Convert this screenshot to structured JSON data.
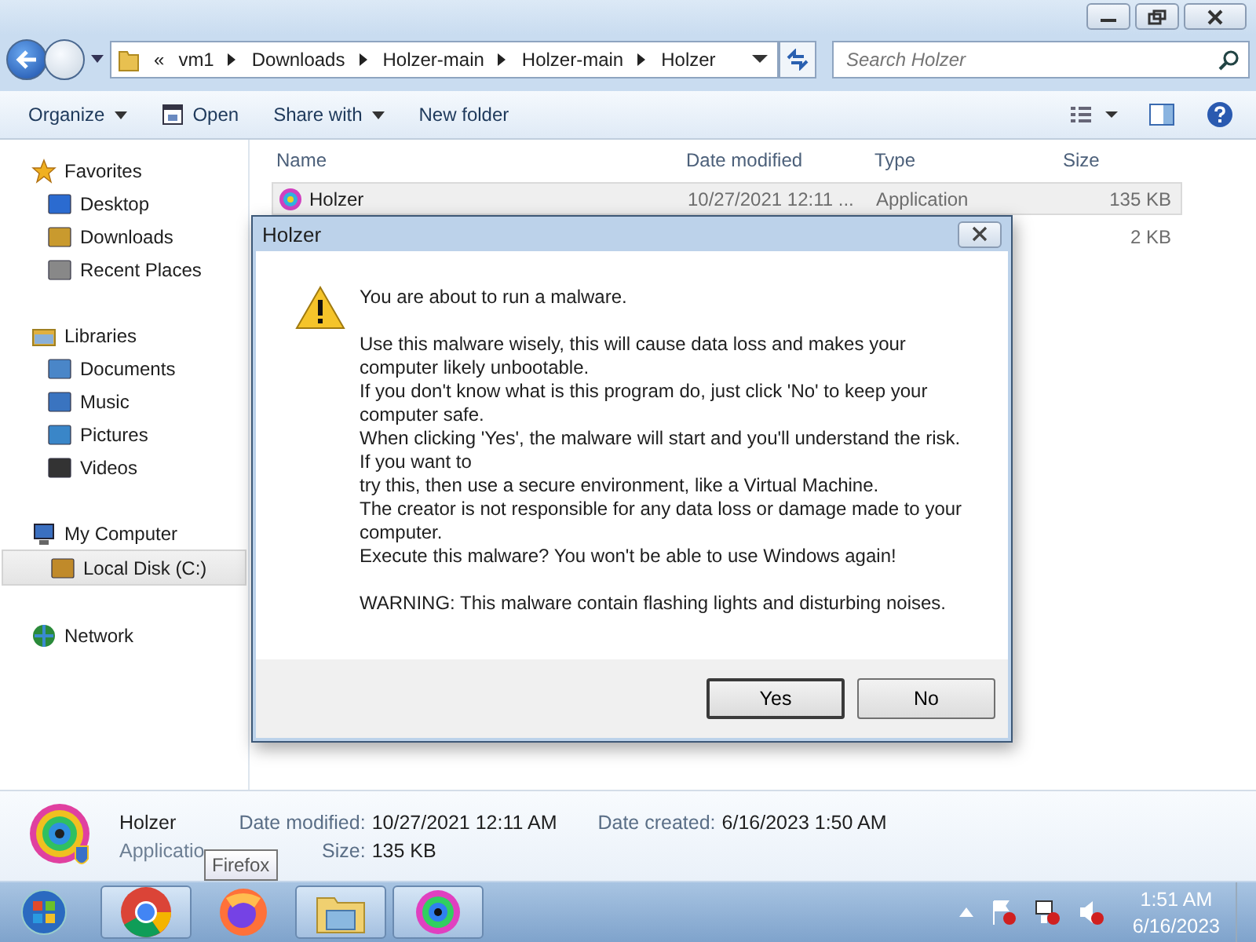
{
  "address_bar": {
    "overflow": "«",
    "segments": [
      "vm1",
      "Downloads",
      "Holzer-main",
      "Holzer-main",
      "Holzer"
    ]
  },
  "search": {
    "placeholder": "Search Holzer"
  },
  "toolbar": {
    "items": [
      {
        "label": "Organize",
        "kind": "dropdown"
      },
      {
        "label": "Open",
        "kind": "icon"
      },
      {
        "label": "Share with",
        "kind": "dropdown"
      },
      {
        "label": "New folder",
        "kind": "plain"
      }
    ]
  },
  "nav_pane": {
    "groups": [
      {
        "label": "Favorites",
        "selected": false,
        "children": [
          {
            "label": "Desktop",
            "selected": false
          },
          {
            "label": "Downloads",
            "selected": false
          },
          {
            "label": "Recent Places",
            "selected": false
          }
        ]
      },
      {
        "label": "Libraries",
        "selected": false,
        "children": [
          {
            "label": "Documents",
            "selected": false
          },
          {
            "label": "Music",
            "selected": false
          },
          {
            "label": "Pictures",
            "selected": false
          },
          {
            "label": "Videos",
            "selected": false
          }
        ]
      },
      {
        "label": "My Computer",
        "selected": false,
        "children": [
          {
            "label": "Local Disk (C:)",
            "selected": true
          }
        ]
      },
      {
        "label": "Network",
        "selected": false
      }
    ]
  },
  "file_list": {
    "columns": [
      "Name",
      "Date modified",
      "Type",
      "Size"
    ],
    "rows": [
      {
        "name": "Holzer",
        "date_modified": "10/27/2021 12:11 ...",
        "type": "Application",
        "size": "135 KB",
        "selected": true
      },
      {
        "size": "2 KB",
        "selected": false
      }
    ]
  },
  "dialog": {
    "title": "Holzer",
    "paragraphs": [
      "You are about to run a malware.",
      "Use this malware wisely, this will cause data loss and makes your computer likely unbootable.\nIf you don't know what is this program do, just click 'No' to keep your computer safe.\nWhen clicking 'Yes', the malware will start and you'll understand the risk. If you want to\ntry this, then use a secure environment, like a Virtual Machine.\nThe creator is not responsible for any data loss or damage made to your computer.\nExecute this malware? You won't be able to use Windows again!",
      "WARNING: This malware contain flashing lights and disturbing noises."
    ],
    "buttons": [
      {
        "label": "Yes",
        "default": true
      },
      {
        "label": "No",
        "default": false
      }
    ]
  },
  "details_pane": {
    "name": "Holzer",
    "file_type": "Applicatio",
    "fields": [
      {
        "label": "Date modified:",
        "value": "10/27/2021 12:11 AM"
      },
      {
        "label": "Date created:",
        "value": "6/16/2023 1:50 AM"
      },
      {
        "label": "Size:",
        "value": "135 KB"
      }
    ]
  },
  "tooltip": {
    "text": "Firefox"
  },
  "taskbar": {
    "apps": [
      {
        "kind": "chrome",
        "running": true
      },
      {
        "kind": "firefox",
        "running": false
      },
      {
        "kind": "explorer",
        "running": true
      },
      {
        "kind": "holzer",
        "running": true
      }
    ]
  },
  "clock": {
    "time": "1:51 AM",
    "date": "6/16/2023"
  }
}
